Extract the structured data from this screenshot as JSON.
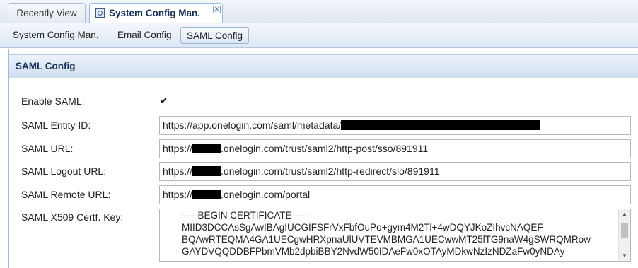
{
  "top_tabs": {
    "recent_label": "Recently View",
    "active_label": "System Config Man.",
    "close_glyph": "✕"
  },
  "sub_tabs": [
    {
      "label": "System Config Man."
    },
    {
      "label": "Email Config"
    },
    {
      "label": "SAML Config"
    }
  ],
  "panel": {
    "title": "SAML Config"
  },
  "fields": {
    "enable_saml": {
      "label": "Enable SAML:",
      "checked": true,
      "glyph": "✔"
    },
    "entity_id": {
      "label": "SAML Entity ID:",
      "value_prefix": "https://app.onelogin.com/saml/metadata/",
      "value_suffix": ""
    },
    "saml_url": {
      "label": "SAML URL:",
      "value_prefix": "https://",
      "value_suffix": ".onelogin.com/trust/saml2/http-post/sso/891911"
    },
    "logout_url": {
      "label": "SAML Logout URL:",
      "value_prefix": "https://",
      "value_suffix": ".onelogin.com/trust/saml2/http-redirect/slo/891911"
    },
    "remote_url": {
      "label": "SAML Remote URL:",
      "value_prefix": "https://",
      "value_suffix": ".onelogin.com/portal"
    },
    "x509": {
      "label": "SAML X509 Certf. Key:",
      "lines": [
        "-----BEGIN CERTIFICATE-----",
        "MIID3DCCAsSgAwIBAgIUCGIFSFrVxFbfOuPo+gym4M2Tl+4wDQYJKoZIhvcNAQEF",
        "BQAwRTEQMA4GA1UECgwHRXpnaUlUVTEVMBMGA1UECwwMT25lTG9naW4gSWRQMRow",
        "GAYDVQQDDBFPbmVMb2dpbiBBY2NvdW50IDAeFw0xOTAyMDkwNzIzNDZaFw0yNDAy"
      ]
    }
  },
  "scrollbar": {
    "up_glyph": "▲",
    "down_glyph": "▼"
  }
}
